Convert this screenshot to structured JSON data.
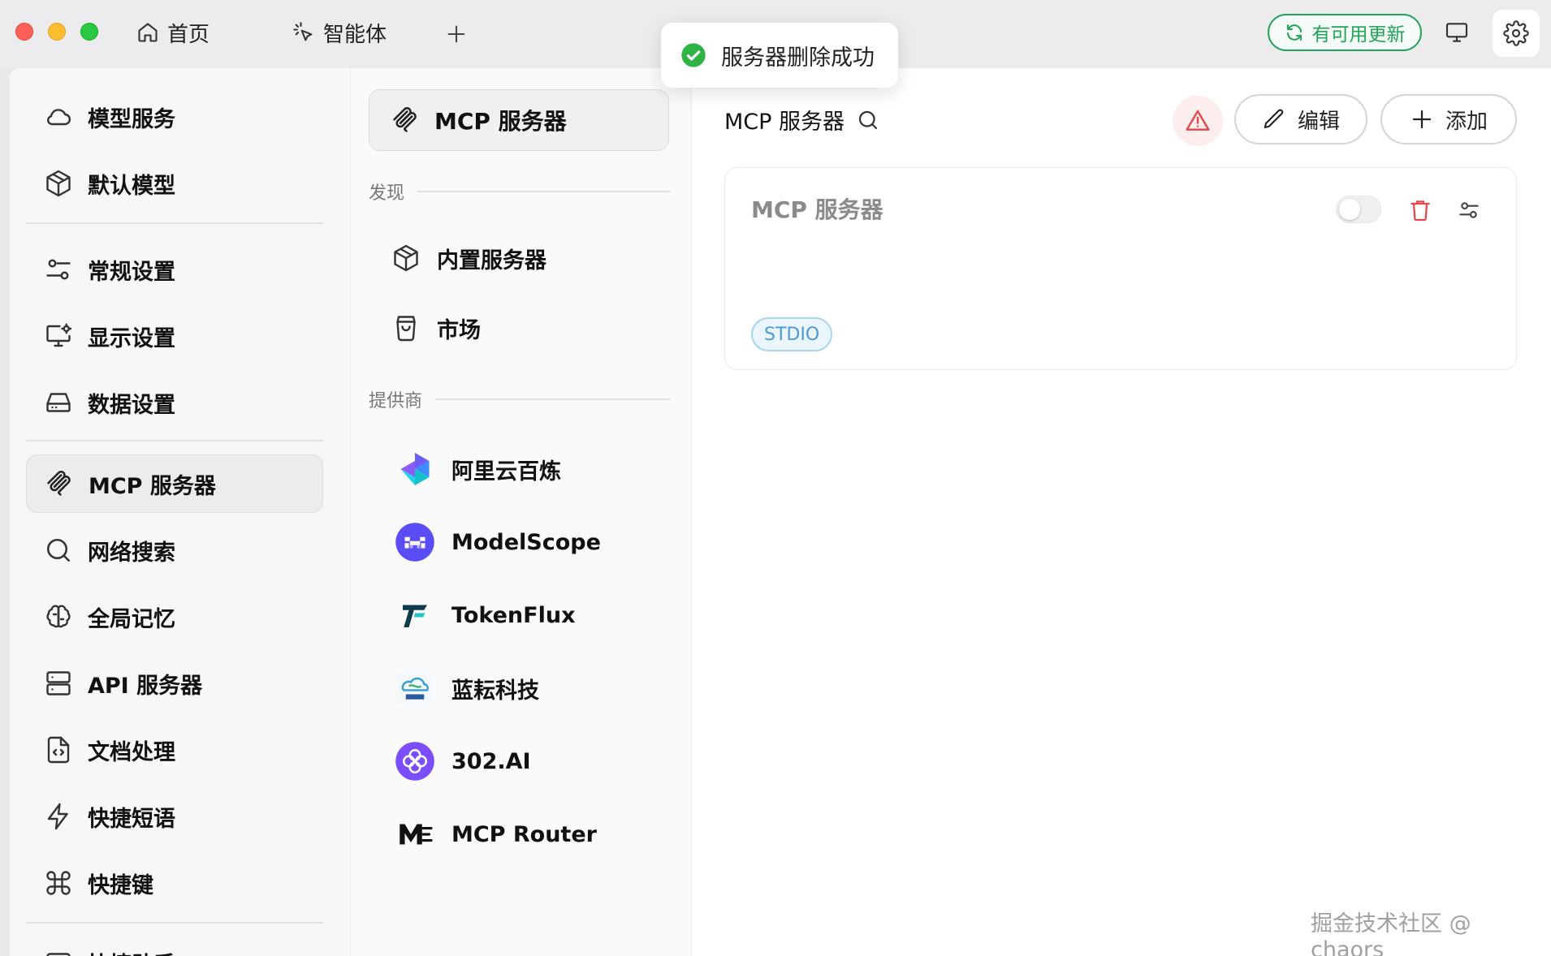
{
  "titlebar": {
    "tabs": [
      {
        "label": "首页",
        "icon": "home-icon"
      },
      {
        "label": "智能体",
        "icon": "sparkle-cursor-icon"
      }
    ],
    "update_label": "有可用更新"
  },
  "toast": {
    "message": "服务器删除成功",
    "icon": "check-circle-icon",
    "color": "#2fb344"
  },
  "sidebar": {
    "items": [
      {
        "label": "模型服务",
        "icon": "cloud-icon"
      },
      {
        "label": "默认模型",
        "icon": "cube-icon"
      },
      {
        "label": "常规设置",
        "icon": "sliders-icon"
      },
      {
        "label": "显示设置",
        "icon": "monitor-settings-icon"
      },
      {
        "label": "数据设置",
        "icon": "hard-drive-icon"
      },
      {
        "label": "MCP 服务器",
        "icon": "mcp-icon",
        "active": true
      },
      {
        "label": "网络搜索",
        "icon": "search-icon"
      },
      {
        "label": "全局记忆",
        "icon": "brain-icon"
      },
      {
        "label": "API 服务器",
        "icon": "server-icon"
      },
      {
        "label": "文档处理",
        "icon": "file-code-icon"
      },
      {
        "label": "快捷短语",
        "icon": "zap-icon"
      },
      {
        "label": "快捷键",
        "icon": "command-icon"
      },
      {
        "label": "快捷助手",
        "icon": "assistant-icon"
      }
    ]
  },
  "mcp_panel": {
    "top_label": "MCP 服务器",
    "discover_heading": "发现",
    "discover_items": [
      {
        "label": "内置服务器",
        "icon": "cube-icon"
      },
      {
        "label": "市场",
        "icon": "shopping-bag-icon"
      }
    ],
    "providers_heading": "提供商",
    "providers": [
      {
        "label": "阿里云百炼",
        "icon": "bailian-logo-icon"
      },
      {
        "label": "ModelScope",
        "icon": "modelscope-logo-icon"
      },
      {
        "label": "TokenFlux",
        "icon": "tokenflux-logo-icon"
      },
      {
        "label": "蓝耘科技",
        "icon": "lanyun-logo-icon"
      },
      {
        "label": "302.AI",
        "icon": "302ai-logo-icon"
      },
      {
        "label": "MCP Router",
        "icon": "mcp-router-logo-icon"
      }
    ]
  },
  "main": {
    "title": "MCP 服务器",
    "edit_label": "编辑",
    "add_label": "添加",
    "server_card": {
      "name": "MCP 服务器",
      "enabled": false,
      "type_badge": "STDIO"
    }
  },
  "colors": {
    "accent_green": "#22a35a",
    "danger_red": "#e5484d",
    "badge_blue": "#4c9bd4"
  },
  "watermark": "掘金技术社区 @ chaors"
}
